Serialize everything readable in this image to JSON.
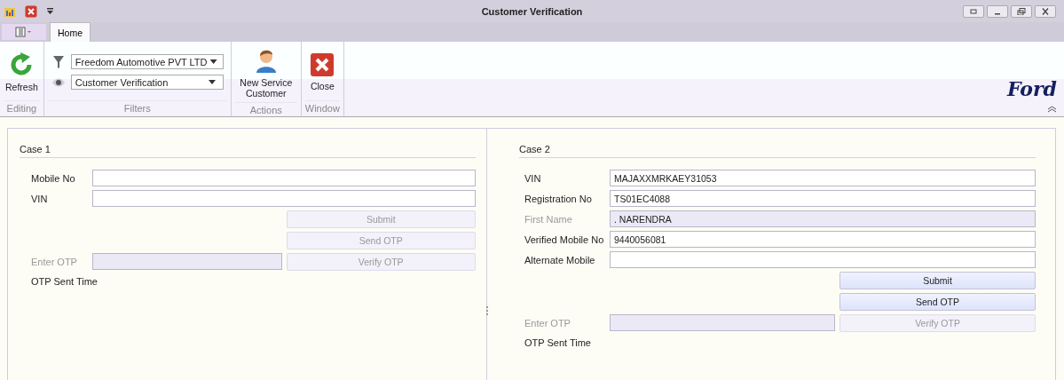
{
  "window": {
    "title": "Customer Verification"
  },
  "tabs": [
    {
      "label": "Home",
      "selected": true
    }
  ],
  "ribbon": {
    "groups": [
      {
        "label": "Editing",
        "items": [
          {
            "kind": "large",
            "label": "Refresh"
          }
        ]
      },
      {
        "label": "Filters",
        "items": [
          {
            "kind": "combo",
            "value": "Freedom Automotive PVT LTD"
          },
          {
            "kind": "combo",
            "value": "Customer Verification"
          }
        ]
      },
      {
        "label": "Actions",
        "items": [
          {
            "kind": "large",
            "label": "New Service Customer"
          }
        ]
      },
      {
        "label": "Window",
        "items": [
          {
            "kind": "large",
            "label": "Close"
          }
        ]
      }
    ],
    "logo": "Ford"
  },
  "cases": [
    {
      "title": "Case 1",
      "fields": [
        {
          "label": "Mobile No",
          "disabled": false
        },
        {
          "label": "VIN",
          "disabled": false
        }
      ],
      "buttons": [
        {
          "label": "Submit",
          "disabled": true
        },
        {
          "label": "Send OTP",
          "disabled": true
        }
      ],
      "otp": {
        "label": "Enter OTP",
        "disabled": true,
        "button": "Verify OTP",
        "button_disabled": true
      },
      "sent_time": "OTP Sent Time"
    },
    {
      "title": "Case 2",
      "fields": [
        {
          "label": "VIN",
          "value": "MAJAXXMRKAEY31053",
          "disabled": false
        },
        {
          "label": "Registration No",
          "value": "TS01EC4088",
          "disabled": false
        },
        {
          "label": "First Name",
          "value": ". NARENDRA",
          "disabled": true
        },
        {
          "label": "Verified Mobile No",
          "value": "9440056081",
          "disabled": false
        },
        {
          "label": "Alternate Mobile",
          "disabled": false
        }
      ],
      "buttons": [
        {
          "label": "Submit",
          "disabled": false
        },
        {
          "label": "Send OTP",
          "disabled": false
        }
      ],
      "otp": {
        "label": "Enter OTP",
        "disabled": true,
        "button": "Verify OTP",
        "button_disabled": true
      },
      "sent_time": "OTP Sent Time"
    }
  ]
}
